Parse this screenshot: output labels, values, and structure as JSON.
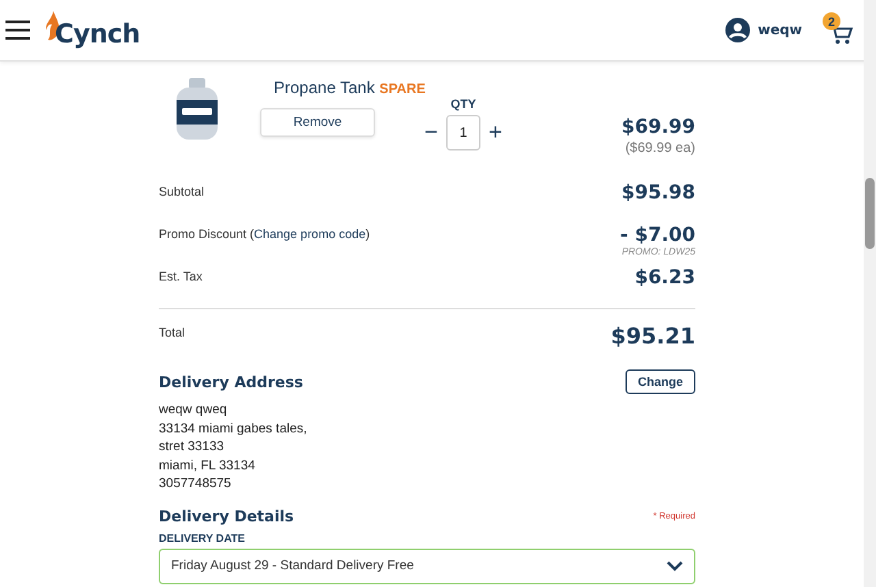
{
  "header": {
    "logo": "Cynch",
    "user": "weqw",
    "cart_count": "2"
  },
  "item": {
    "name": "Propane Tank",
    "tag": "SPARE",
    "remove": "Remove",
    "qty_label": "QTY",
    "minus": "−",
    "qty": "1",
    "plus": "+",
    "price": "$69.99",
    "unit_price": "($69.99 ea)"
  },
  "summary": [
    {
      "label": "Subtotal",
      "value": "$95.98"
    },
    {
      "label": "Promo Discount (",
      "link": "Change promo code",
      "label_end": ")",
      "value": "- $7.00",
      "note": "PROMO: LDW25"
    },
    {
      "label": "Est. Tax",
      "value": "$6.23"
    }
  ],
  "total": {
    "label": "Total",
    "value": "$95.21"
  },
  "address": {
    "title": "Delivery Address",
    "change": "Change",
    "lines": [
      "weqw qweq",
      "33134 miami gabes tales,",
      "stret 33133",
      "miami, FL 33134",
      "3057748575"
    ]
  },
  "details": {
    "title": "Delivery Details",
    "required": "* Required",
    "date_label": "DELIVERY DATE",
    "date_value": "Friday August 29 - Standard Delivery Free"
  }
}
